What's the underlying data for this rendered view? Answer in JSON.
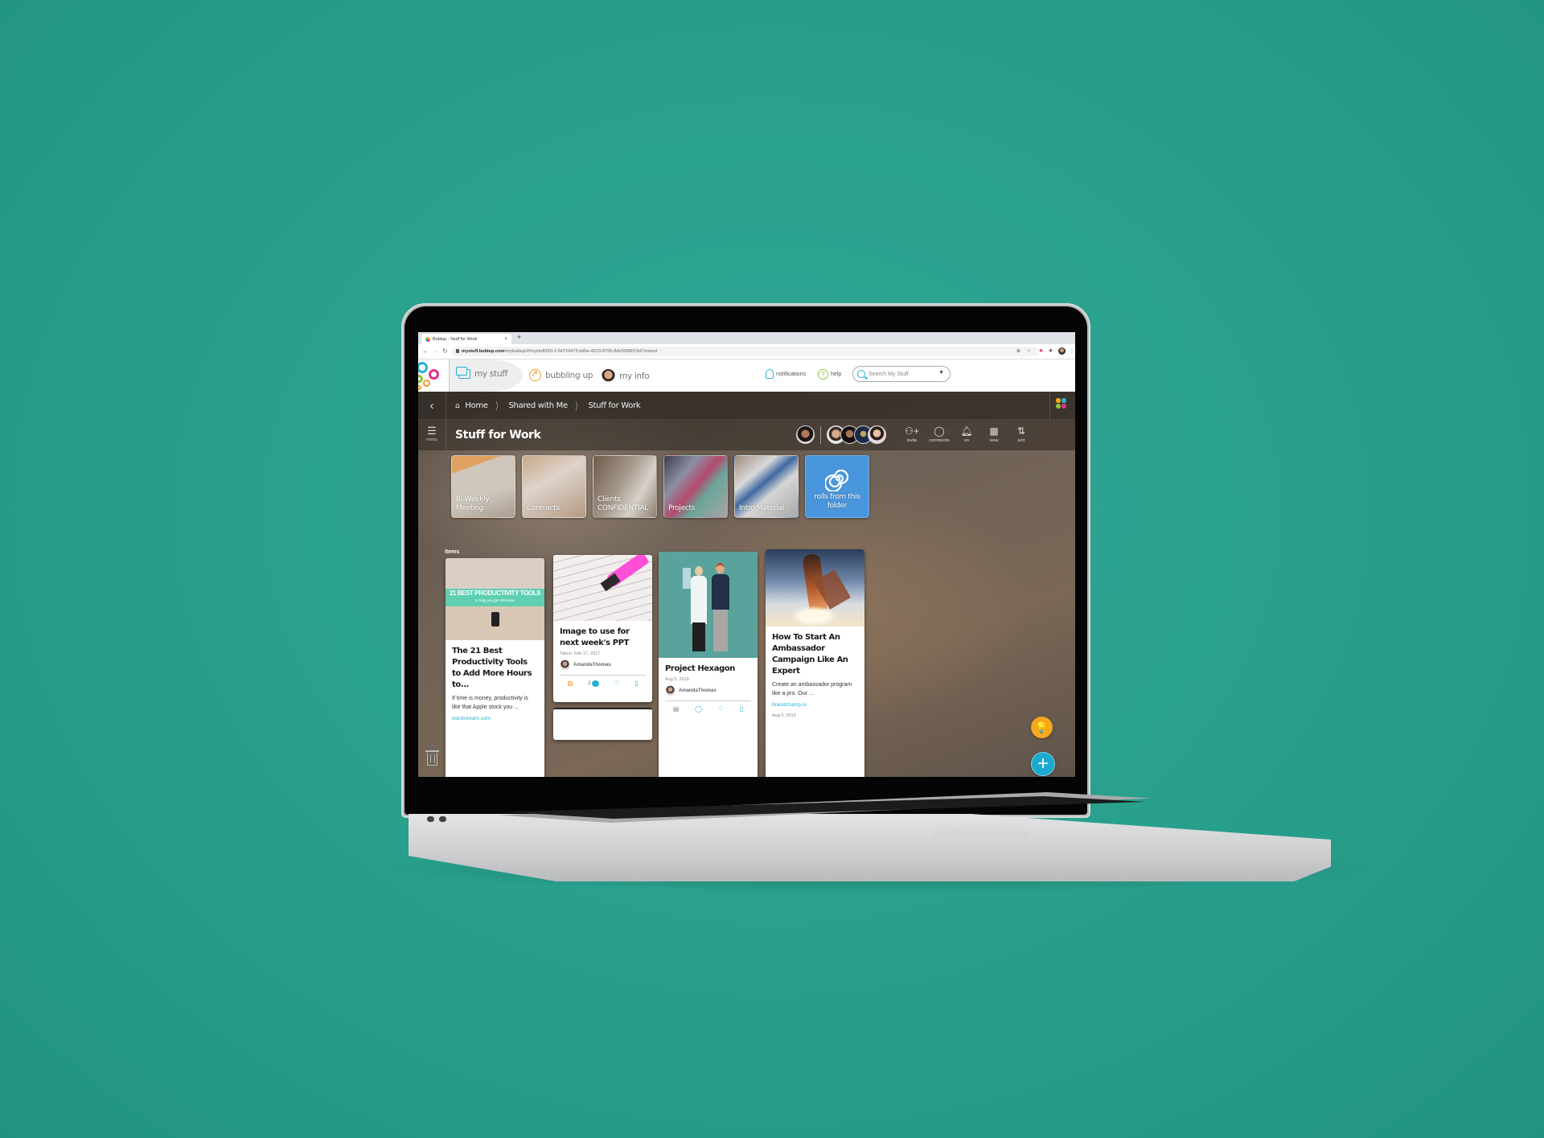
{
  "browser": {
    "tab_title": "Bublup - Stuff for Work",
    "tab_close": "×",
    "new_tab": "+",
    "url_domain": "mystuff.bublup.com",
    "url_path": "/mybublup/#/mystuff/001-f-34724473-bd6e-4223-8755-8de5098519d7/mixed",
    "nav": {
      "back": "←",
      "forward": "→",
      "reload": "C"
    },
    "extensions": [
      "zoom-icon",
      "star-icon",
      "bublup-extension-icon",
      "puzzle-icon",
      "profile-avatar",
      "kebab-menu-icon"
    ]
  },
  "header": {
    "nav": [
      {
        "label": "my stuff",
        "icon": "folder-icon",
        "active": true
      },
      {
        "label": "bubbling up",
        "icon": "trend-icon",
        "active": false
      },
      {
        "label": "my info",
        "icon": "avatar",
        "active": false
      }
    ],
    "notifications_label": "notifications",
    "help_label": "help",
    "search_placeholder": "Search My Stuff"
  },
  "breadcrumb": {
    "items": [
      "Home",
      "Shared with Me",
      "Stuff for Work"
    ]
  },
  "titlebar": {
    "title": "Stuff for Work",
    "menu_label": "menu",
    "owner_count": 1,
    "member_count": 4,
    "tools": [
      {
        "label": "invite",
        "icon": "invite-icon"
      },
      {
        "label": "comments",
        "icon": "comments-icon"
      },
      {
        "label": "on",
        "icon": "bell-icon"
      },
      {
        "label": "view",
        "icon": "view-icon"
      },
      {
        "label": "sort",
        "icon": "sort-icon"
      }
    ]
  },
  "folders": [
    {
      "label_line1": "Bi-Weekly",
      "label_line2": "Meeting"
    },
    {
      "label_line1": "Contracts",
      "label_line2": ""
    },
    {
      "label_line1": "Clients",
      "label_line2": "CONFIDENTIAL"
    },
    {
      "label_line1": "Projects",
      "label_line2": ""
    },
    {
      "label_line1": "Intro Material",
      "label_line2": ""
    },
    {
      "label_line1": "rolls from this",
      "label_line2": "folder"
    }
  ],
  "items_label": "items",
  "cards": [
    {
      "image_banner": "21 BEST PRODUCTIVITY TOOLS",
      "image_subtitle": "to help you get shit done",
      "title": "The 21 Best Productivity Tools to Add More Hours to...",
      "description": "If time is money, productivity is like that Apple stock you ...",
      "source": "wordstream.com"
    },
    {
      "title": "Image to use for next week's PPT",
      "meta": "Taken: Feb 17, 2017",
      "owner": "AmandaThomas",
      "comment_count": "2"
    },
    {
      "title": "Project Hexagon",
      "meta": "Aug 5, 2019",
      "owner": "AmandaThomas"
    },
    {
      "title": "How To Start An Ambassador Campaign Like An Expert",
      "description": "Create an ambassador program like a pro. Our ...",
      "source": "brandchamp.io",
      "meta": "Aug 5, 2019"
    }
  ],
  "colors": {
    "background": "#29a18d",
    "accent_blue": "#27b2d1",
    "accent_orange": "#f39a2c",
    "accent_green": "#8bc43f",
    "accent_pink": "#e5308a",
    "rolls_tile": "#4a96dc",
    "fab_idea": "#f6a81d",
    "fab_add": "#1aa9cf"
  },
  "icons": {
    "back": "‹",
    "menu": "☰",
    "home": "⌂",
    "separator": "〉",
    "idea": "💡",
    "add": "+"
  }
}
